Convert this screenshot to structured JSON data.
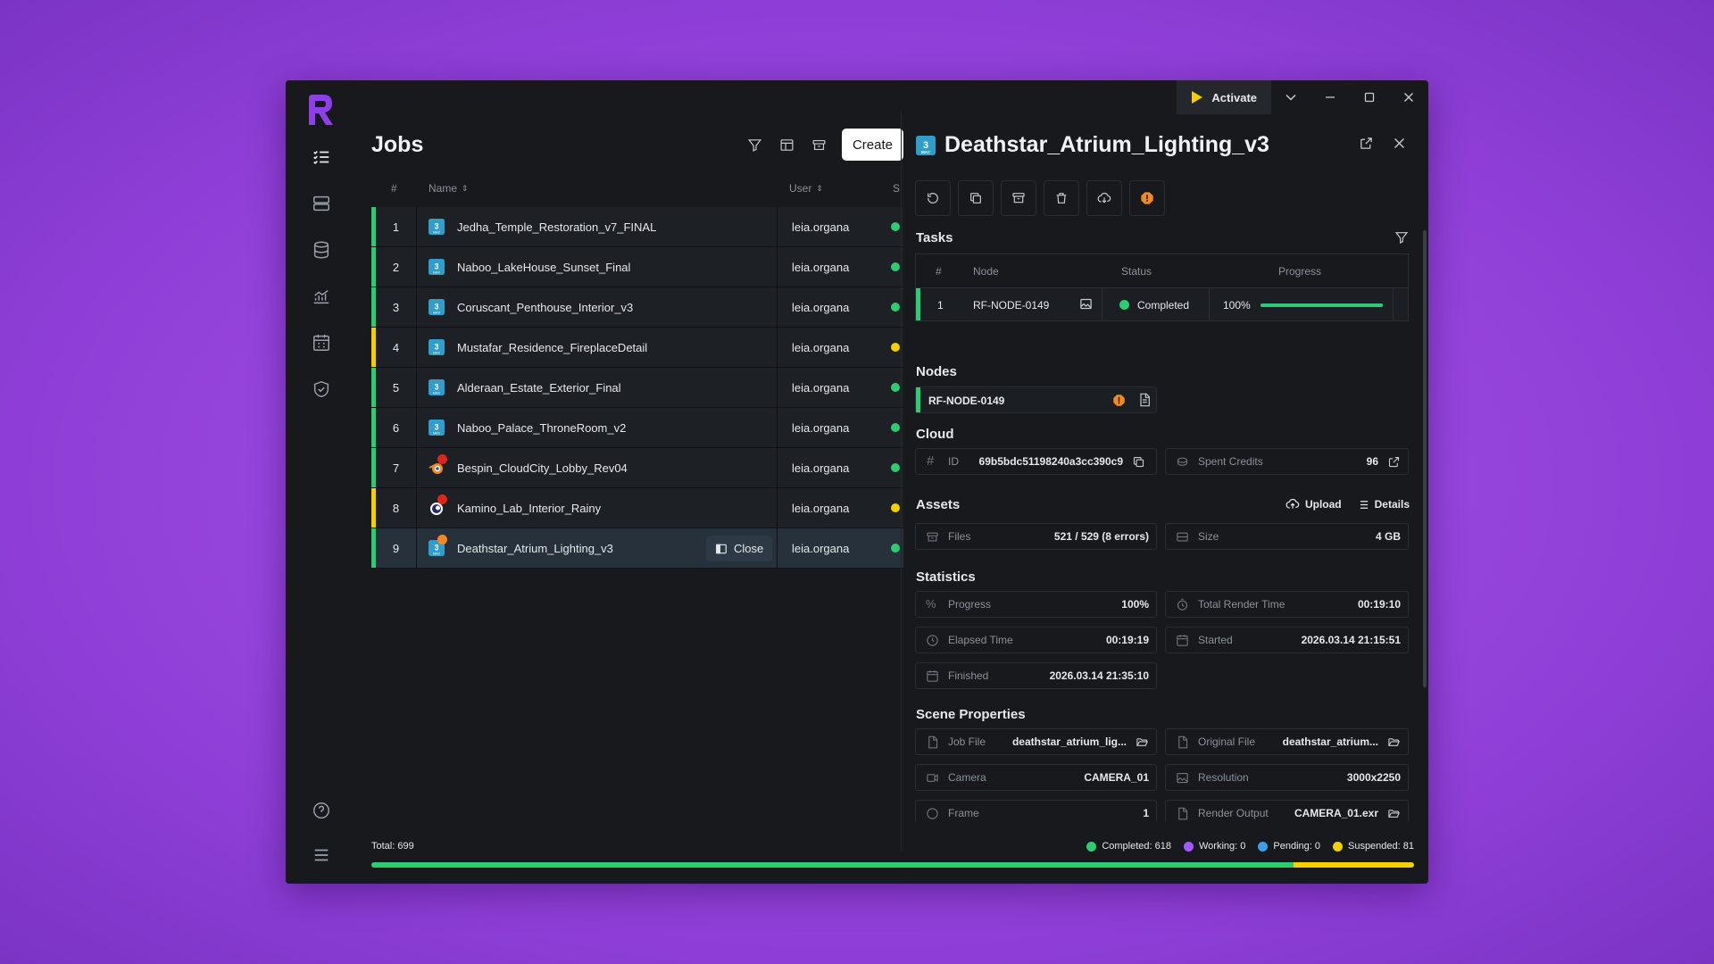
{
  "window": {
    "activate_label": "Activate"
  },
  "sidebar": {
    "items": [
      "jobs-icon",
      "servers-icon",
      "database-icon",
      "analytics-icon",
      "calendar-icon",
      "shield-icon"
    ],
    "bottom": [
      "help-icon",
      "menu-icon"
    ]
  },
  "jobs": {
    "title": "Jobs",
    "create_label": "Create",
    "columns": {
      "num": "#",
      "name": "Name",
      "user": "User",
      "extra": "S"
    },
    "rows": [
      {
        "num": "1",
        "name": "Jedha_Temple_Restoration_v7_FINAL",
        "user": "leia.organa",
        "status_color": "#2ecc71",
        "icon": "3ds-max-icon"
      },
      {
        "num": "2",
        "name": "Naboo_LakeHouse_Sunset_Final",
        "user": "leia.organa",
        "status_color": "#2ecc71",
        "icon": "3ds-max-icon"
      },
      {
        "num": "3",
        "name": "Coruscant_Penthouse_Interior_v3",
        "user": "leia.organa",
        "status_color": "#2ecc71",
        "icon": "3ds-max-icon"
      },
      {
        "num": "4",
        "name": "Mustafar_Residence_FireplaceDetail",
        "user": "leia.organa",
        "status_color": "#f5d000",
        "icon": "3ds-max-icon"
      },
      {
        "num": "5",
        "name": "Alderaan_Estate_Exterior_Final",
        "user": "leia.organa",
        "status_color": "#2ecc71",
        "icon": "3ds-max-icon"
      },
      {
        "num": "6",
        "name": "Naboo_Palace_ThroneRoom_v2",
        "user": "leia.organa",
        "status_color": "#2ecc71",
        "icon": "3ds-max-icon"
      },
      {
        "num": "7",
        "name": "Bespin_CloudCity_Lobby_Rev04",
        "user": "leia.organa",
        "status_color": "#2ecc71",
        "icon": "blender-icon"
      },
      {
        "num": "8",
        "name": "Kamino_Lab_Interior_Rainy",
        "user": "leia.organa",
        "status_color": "#f5d000",
        "icon": "cinema4d-icon"
      },
      {
        "num": "9",
        "name": "Deathstar_Atrium_Lighting_v3",
        "user": "leia.organa",
        "status_color": "#2ecc71",
        "icon": "3ds-max-icon"
      }
    ],
    "close_label": "Close"
  },
  "detail": {
    "title": "Deathstar_Atrium_Lighting_v3",
    "tasks": {
      "label": "Tasks",
      "columns": {
        "num": "#",
        "node": "Node",
        "status": "Status",
        "progress": "Progress"
      },
      "rows": [
        {
          "num": "1",
          "node": "RF-NODE-0149",
          "status": "Completed",
          "progress": "100%",
          "progress_value": 1.0
        }
      ]
    },
    "nodes": {
      "label": "Nodes",
      "items": [
        {
          "name": "RF-NODE-0149"
        }
      ]
    },
    "cloud": {
      "label": "Cloud",
      "id_key": "ID",
      "id_value": "69b5bdc51198240a3cc390c9",
      "credits_key": "Spent Credits",
      "credits_value": "96"
    },
    "assets": {
      "label": "Assets",
      "upload_label": "Upload",
      "details_label": "Details",
      "files_key": "Files",
      "files_value": "521 / 529 (8 errors)",
      "size_key": "Size",
      "size_value": "4 GB"
    },
    "statistics": {
      "label": "Statistics",
      "progress_key": "Progress",
      "progress_value": "100%",
      "total_render_key": "Total Render Time",
      "total_render_value": "00:19:10",
      "elapsed_key": "Elapsed Time",
      "elapsed_value": "00:19:19",
      "started_key": "Started",
      "started_value": "2026.03.14 21:15:51",
      "finished_key": "Finished",
      "finished_value": "2026.03.14 21:35:10"
    },
    "scene": {
      "label": "Scene Properties",
      "job_file_key": "Job File",
      "job_file_value": "deathstar_atrium_lig...",
      "original_file_key": "Original File",
      "original_file_value": "deathstar_atrium...",
      "camera_key": "Camera",
      "camera_value": "CAMERA_01",
      "resolution_key": "Resolution",
      "resolution_value": "3000x2250",
      "frame_key": "Frame",
      "frame_value": "1",
      "render_output_key": "Render Output",
      "render_output_value": "CAMERA_01.exr"
    }
  },
  "footer": {
    "total": "Total: 699",
    "completed": "Completed: 618",
    "completed_count": 618,
    "working": "Working: 0",
    "working_count": 0,
    "pending": "Pending: 0",
    "pending_count": 0,
    "suspended": "Suspended: 81",
    "suspended_count": 81,
    "colors": {
      "completed": "#2ecc71",
      "working": "#a259ff",
      "pending": "#3a9fe8",
      "suspended": "#f5d000"
    }
  }
}
